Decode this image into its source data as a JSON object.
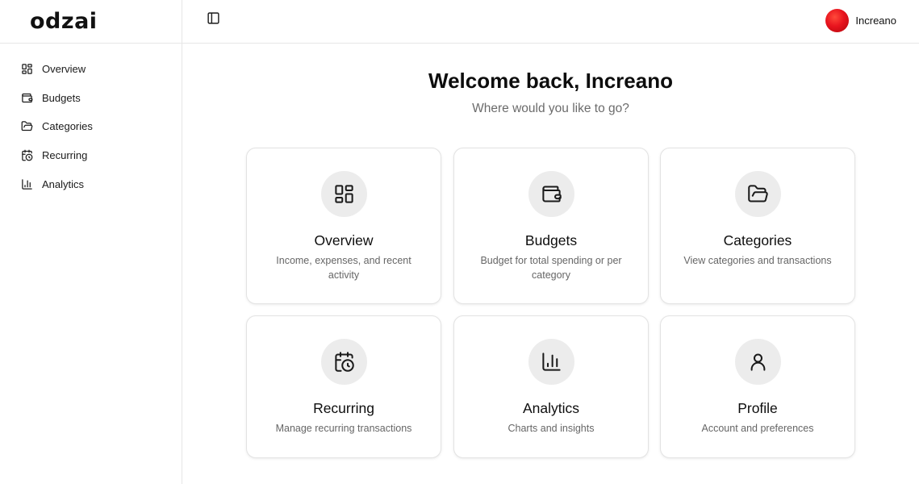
{
  "brand": {
    "name": "odzai"
  },
  "sidebar": {
    "items": [
      {
        "label": "Overview",
        "icon": "grid-icon"
      },
      {
        "label": "Budgets",
        "icon": "wallet-icon"
      },
      {
        "label": "Categories",
        "icon": "folder-open-icon"
      },
      {
        "label": "Recurring",
        "icon": "calendar-clock-icon"
      },
      {
        "label": "Analytics",
        "icon": "bar-chart-icon"
      }
    ]
  },
  "header": {
    "toggle_icon": "sidebar-toggle-icon",
    "user": {
      "name": "Increano",
      "avatar_color": "#e8141e"
    }
  },
  "main": {
    "welcome": "Welcome back, Increano",
    "subtitle": "Where would you like to go?",
    "cards": [
      {
        "title": "Overview",
        "description": "Income, expenses, and recent activity",
        "icon": "grid-icon"
      },
      {
        "title": "Budgets",
        "description": "Budget for total spending or per category",
        "icon": "wallet-icon"
      },
      {
        "title": "Categories",
        "description": "View categories and transactions",
        "icon": "folder-open-icon"
      },
      {
        "title": "Recurring",
        "description": "Manage recurring transactions",
        "icon": "calendar-clock-icon"
      },
      {
        "title": "Analytics",
        "description": "Charts and insights",
        "icon": "bar-chart-icon"
      },
      {
        "title": "Profile",
        "description": "Account and preferences",
        "icon": "user-icon"
      }
    ]
  },
  "colors": {
    "border": "#e6e6e6",
    "icon_circle": "#ececec",
    "muted_text": "#6b6b6b"
  }
}
